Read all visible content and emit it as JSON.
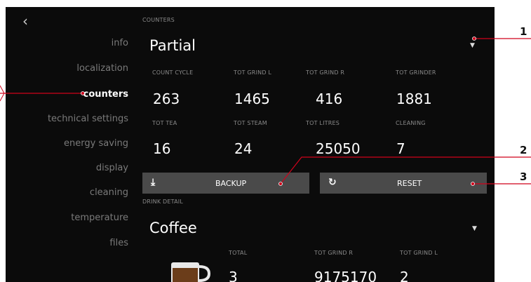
{
  "header": {
    "back_icon": "chevron-left-icon",
    "section_label": "COUNTERS"
  },
  "sidebar": {
    "items": [
      {
        "label": "info"
      },
      {
        "label": "localization"
      },
      {
        "label": "counters",
        "active": true
      },
      {
        "label": "technical settings"
      },
      {
        "label": "energy saving"
      },
      {
        "label": "display"
      },
      {
        "label": "cleaning"
      },
      {
        "label": "temperature"
      },
      {
        "label": "files"
      }
    ]
  },
  "counters": {
    "mode": "Partial",
    "row1": [
      {
        "label": "COUNT CYCLE",
        "value": "263"
      },
      {
        "label": "TOT GRIND L",
        "value": "1465"
      },
      {
        "label": "TOT GRIND R",
        "value": "416"
      },
      {
        "label": "TOT GRINDER",
        "value": "1881"
      }
    ],
    "row2": [
      {
        "label": "TOT TEA",
        "value": "16"
      },
      {
        "label": "TOT STEAM",
        "value": "24"
      },
      {
        "label": "TOT LITRES",
        "value": "25050"
      },
      {
        "label": "CLEANING",
        "value": "7"
      }
    ]
  },
  "buttons": {
    "backup_label": "BACKUP",
    "backup_icon": "download-icon",
    "reset_label": "RESET",
    "reset_icon": "refresh-icon"
  },
  "drink_detail": {
    "section_label": "DRINK DETAIL",
    "drink": "Coffee",
    "columns": [
      {
        "label": "TOTAL",
        "value": "3"
      },
      {
        "label": "TOT GRIND R",
        "value": "9175170"
      },
      {
        "label": "TOT GRIND L",
        "value": "2"
      }
    ]
  },
  "callouts": [
    "1",
    "2",
    "3"
  ],
  "colors": {
    "screen_bg": "#0b0b0b",
    "button_bg": "#4a4a4a",
    "callout_line": "#d0021b"
  }
}
